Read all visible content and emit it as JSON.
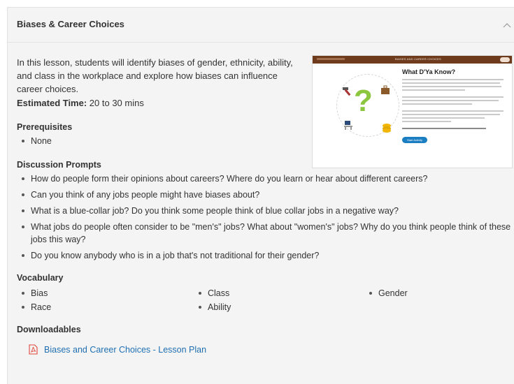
{
  "header": {
    "title": "Biases & Career Choices"
  },
  "intro": "In this lesson, students will identify biases of gender, ethnicity, ability, and class in the workplace and explore how biases can influence career choices.",
  "estimated_time": {
    "label": "Estimated Time:",
    "value": " 20 to 30 mins"
  },
  "prerequisites": {
    "title": "Prerequisites",
    "items": [
      "None"
    ]
  },
  "discussion": {
    "title": "Discussion Prompts",
    "items": [
      "How do people form their opinions about careers? Where do you learn or hear about different careers?",
      "Can you think of any jobs people might have biases about?",
      "What is a blue-collar job? Do you think some people think of blue collar jobs in a negative way?",
      "What jobs do people often consider to be \"men's\" jobs? What about \"women's\" jobs? Why do you think people think of these jobs this way?",
      "Do you know anybody who is in a job that's not traditional for their gender?"
    ]
  },
  "vocabulary": {
    "title": "Vocabulary",
    "items": [
      "Bias",
      "Class",
      "Gender",
      "Race",
      "Ability"
    ]
  },
  "downloadables": {
    "title": "Downloadables",
    "link_label": "Biases and Career Choices - Lesson Plan"
  },
  "preview": {
    "bar_title": "BIASES AND CAREER CHOICES",
    "heading": "What D'Ya Know?",
    "button_label": "Start Activity"
  },
  "colors": {
    "link": "#1f6fb2",
    "pdf_icon": "#e0473a",
    "preview_bar": "#6e3b1c",
    "preview_button": "#1c7ec2"
  },
  "icons": {
    "collapse": "chevron-up-icon",
    "pdf": "pdf-file-icon"
  }
}
